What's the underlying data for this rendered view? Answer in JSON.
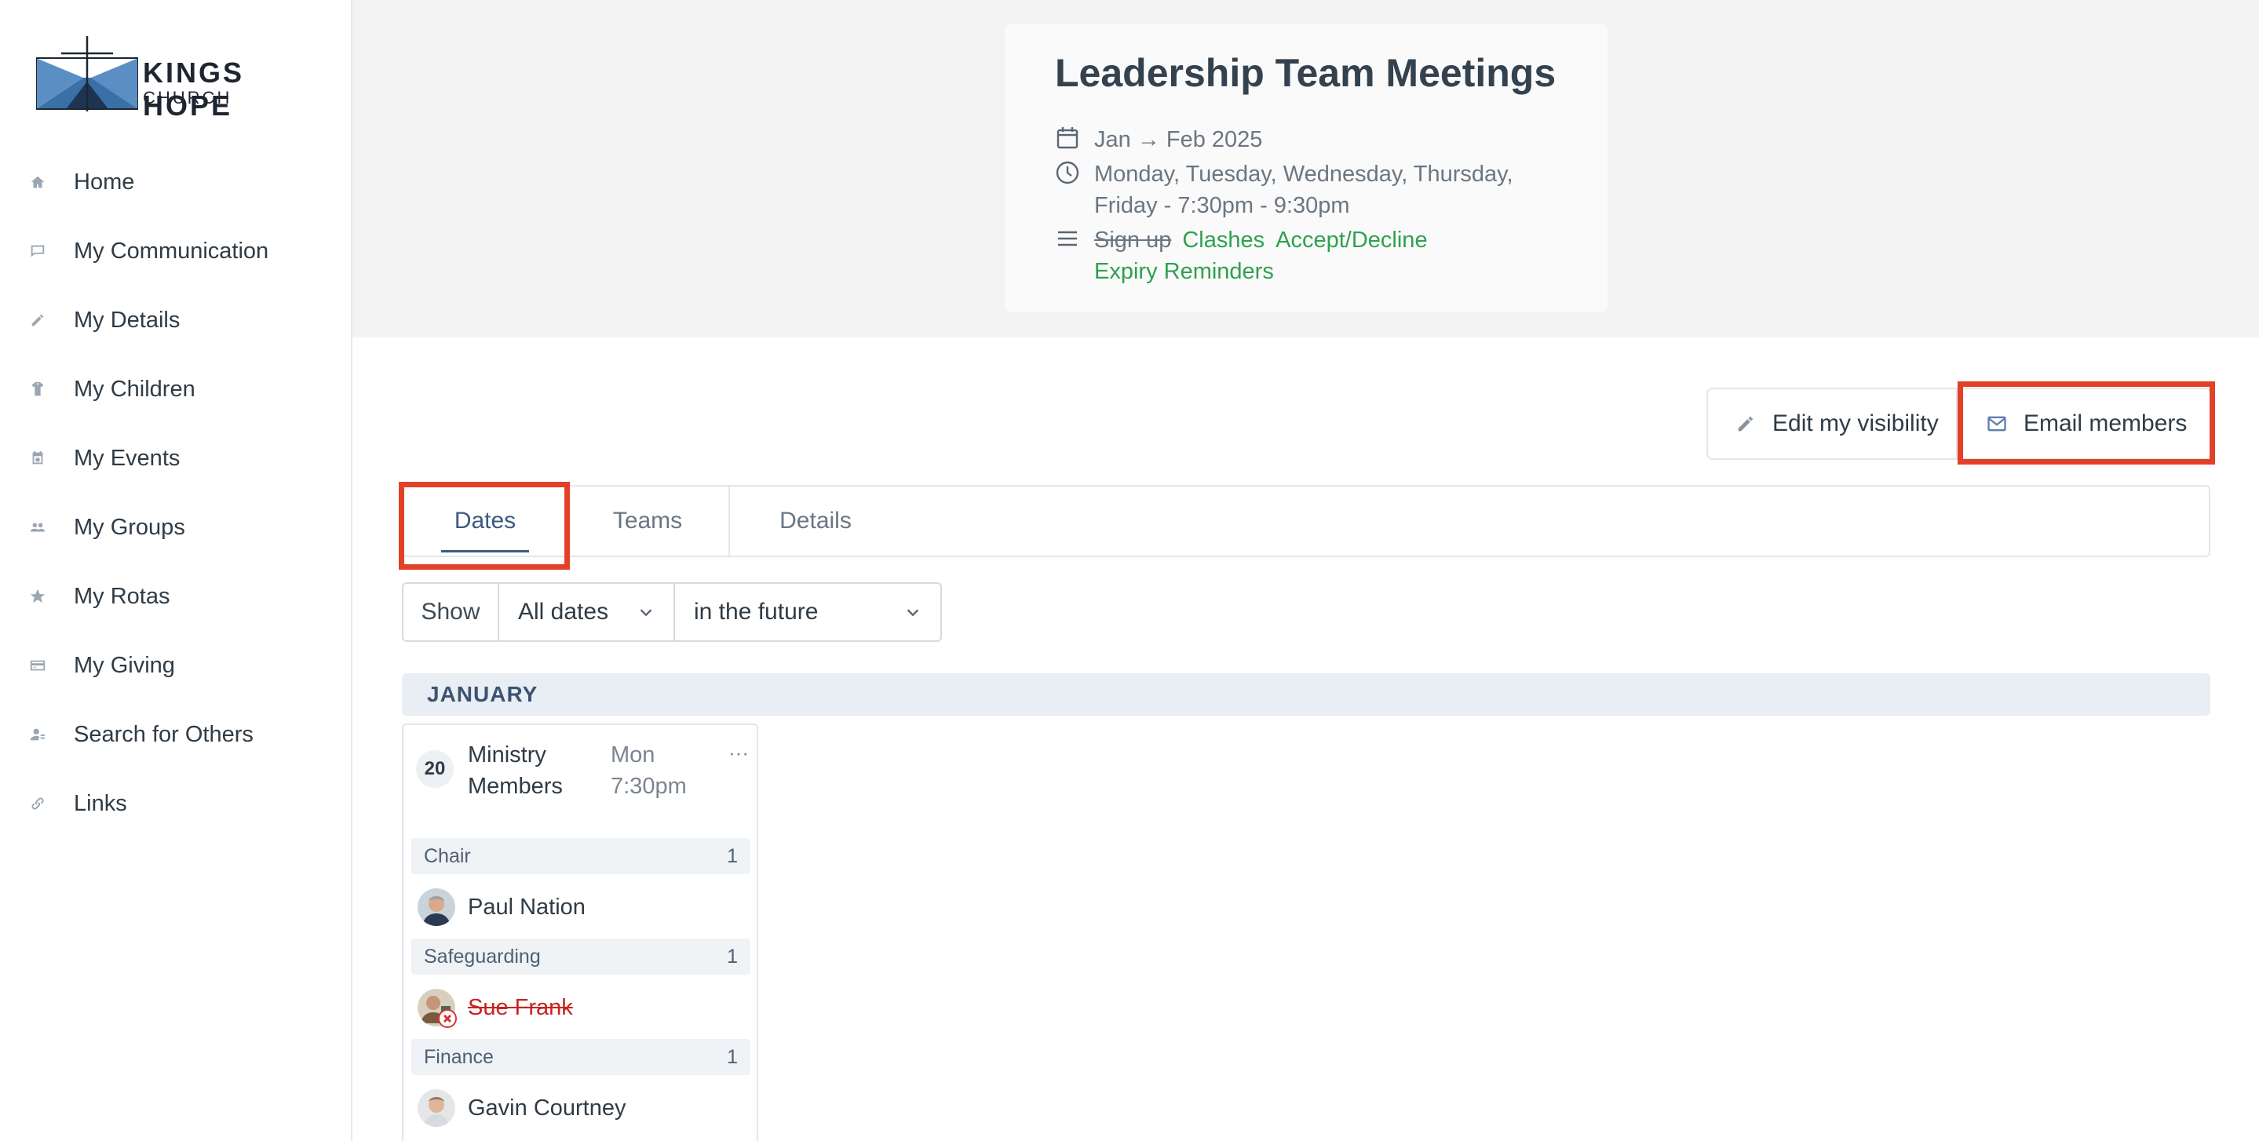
{
  "logo": {
    "line1": "KINGS HOPE",
    "line2": "CHURCH"
  },
  "sidebar": {
    "items": [
      {
        "label": "Home",
        "icon": "home-icon"
      },
      {
        "label": "My Communication",
        "icon": "chat-icon"
      },
      {
        "label": "My Details",
        "icon": "pencil-icon"
      },
      {
        "label": "My Children",
        "icon": "child-icon"
      },
      {
        "label": "My Events",
        "icon": "calendar-icon"
      },
      {
        "label": "My Groups",
        "icon": "group-icon"
      },
      {
        "label": "My Rotas",
        "icon": "star-icon"
      },
      {
        "label": "My Giving",
        "icon": "card-icon"
      },
      {
        "label": "Search for Others",
        "icon": "person-search-icon"
      },
      {
        "label": "Links",
        "icon": "link-icon"
      }
    ]
  },
  "event": {
    "title": "Leadership Team Meetings",
    "date_range": "Jan → Feb 2025",
    "schedule": "Monday, Tuesday, Wednesday, Thursday, Friday   - 7:30pm - 9:30pm",
    "links": {
      "signup": "Sign up",
      "clashes": "Clashes",
      "accept_decline": "Accept/Decline",
      "expiry": "Expiry Reminders"
    }
  },
  "actions": {
    "edit_visibility": "Edit my visibility",
    "email_members": "Email members"
  },
  "tabs": {
    "dates": "Dates",
    "teams": "Teams",
    "details": "Details"
  },
  "filter": {
    "show": "Show",
    "dates_value": "All dates",
    "range_value": "in the future"
  },
  "month": "JANUARY",
  "date_card": {
    "day": "20",
    "title": "Ministry Members",
    "time": "Mon 7:30pm",
    "more": "···",
    "roles": [
      {
        "name": "Chair",
        "count": "1",
        "person": "Paul Nation"
      },
      {
        "name": "Safeguarding",
        "count": "1",
        "person": "Sue Frank"
      },
      {
        "name": "Finance",
        "count": "1",
        "person": "Gavin Courtney"
      }
    ]
  },
  "colors": {
    "accent_green": "#2fa14f",
    "highlight_red": "#e24128",
    "tab_blue": "#3c5a80",
    "declined_red": "#c8231f"
  }
}
